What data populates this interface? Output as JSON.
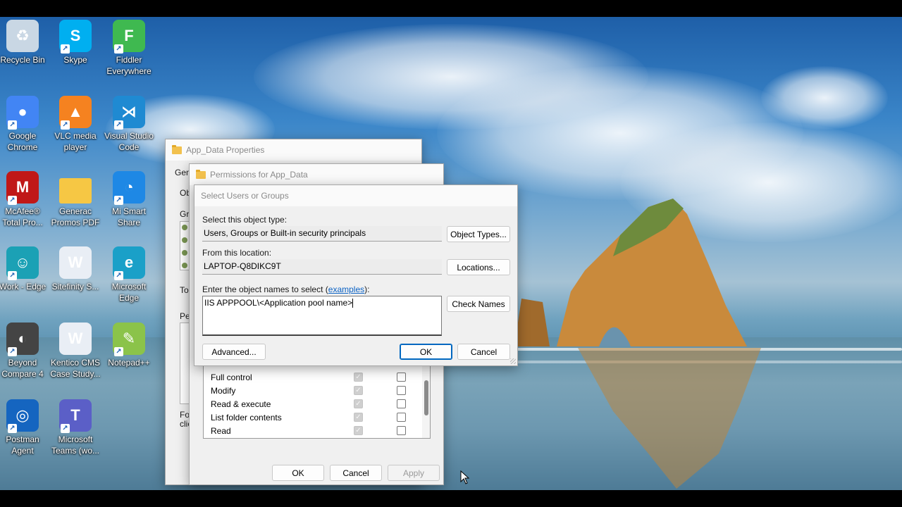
{
  "desktop": {
    "icons": [
      {
        "label": "Recycle Bin",
        "icon": "recycle-bin-icon",
        "color": "#c9d7e4",
        "glyph": "♻"
      },
      {
        "label": "Skype",
        "icon": "skype-icon",
        "color": "#00aff0",
        "glyph": "S"
      },
      {
        "label": "Fiddler Everywhere",
        "icon": "fiddler-icon",
        "color": "#3fb950",
        "glyph": "F"
      },
      {
        "label": "Google Chrome",
        "icon": "chrome-icon",
        "color": "#4285f4",
        "glyph": "●"
      },
      {
        "label": "VLC media player",
        "icon": "vlc-icon",
        "color": "#f58220",
        "glyph": "▲"
      },
      {
        "label": "Visual Studio Code",
        "icon": "vscode-icon",
        "color": "#1f8ad2",
        "glyph": "⋊"
      },
      {
        "label": "McAfee® Total Pro...",
        "icon": "mcafee-icon",
        "color": "#c01818",
        "glyph": "M"
      },
      {
        "label": "Generac Promos PDF",
        "icon": "folder-icon",
        "color": "#f6c744",
        "glyph": ""
      },
      {
        "label": "Mi Smart Share",
        "icon": "mi-smart-share-icon",
        "color": "#1e88e5",
        "glyph": "◔"
      },
      {
        "label": "Work - Edge",
        "icon": "edge-profile-icon",
        "color": "#1ba1b5",
        "glyph": "☺"
      },
      {
        "label": "Sitefinity S...",
        "icon": "word-document-icon",
        "color": "#e9eef5",
        "glyph": "W"
      },
      {
        "label": "Microsoft Edge",
        "icon": "edge-icon",
        "color": "#1aa0c8",
        "glyph": "e"
      },
      {
        "label": "Beyond Compare 4",
        "icon": "beyond-compare-icon",
        "color": "#444444",
        "glyph": "◐"
      },
      {
        "label": "Kentico CMS Case Study...",
        "icon": "word-document-icon",
        "color": "#e9eef5",
        "glyph": "W"
      },
      {
        "label": "Notepad++",
        "icon": "notepad-plus-plus-icon",
        "color": "#8bc34a",
        "glyph": "✎"
      },
      {
        "label": "Postman Agent",
        "icon": "postman-icon",
        "color": "#1565c0",
        "glyph": "◎"
      },
      {
        "label": "Microsoft Teams (wo...",
        "icon": "teams-icon",
        "color": "#5b5fc7",
        "glyph": "T"
      }
    ],
    "shortcut_arrow": "↗"
  },
  "properties_window": {
    "title": "App_Data Properties",
    "tab_fragment": "Gen",
    "frag_ob": "Ob",
    "frag_gr": "Gr",
    "frag_to": "To",
    "frag_pe": "Pe",
    "frag_fo": "Fo",
    "frag_cli": "clic"
  },
  "permissions_window": {
    "title": "Permissions for App_Data",
    "permissions": [
      {
        "name": "Full control"
      },
      {
        "name": "Modify"
      },
      {
        "name": "Read & execute"
      },
      {
        "name": "List folder contents"
      },
      {
        "name": "Read"
      }
    ],
    "check_glyph": "✓",
    "ok_label": "OK",
    "cancel_label": "Cancel",
    "apply_label": "Apply"
  },
  "select_dialog": {
    "title": "Select Users or Groups",
    "object_type_label": "Select this object type:",
    "object_type_value": "Users, Groups or Built-in security principals",
    "object_types_button": "Object Types...",
    "location_label": "From this location:",
    "location_value": "LAPTOP-Q8DIKC9T",
    "locations_button": "Locations...",
    "names_label_prefix": "Enter the object names to select (",
    "names_label_link": "examples",
    "names_label_suffix": "):",
    "names_value": "IIS APPPOOL\\<Application pool name>",
    "check_names_button": "Check Names",
    "advanced_button": "Advanced...",
    "ok_button": "OK",
    "cancel_button": "Cancel"
  }
}
